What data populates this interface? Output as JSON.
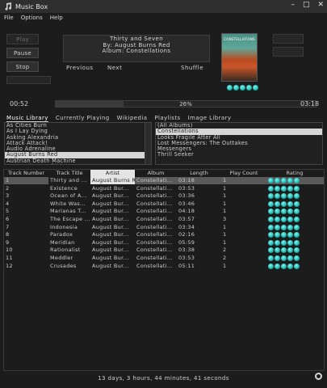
{
  "window": {
    "title": "Music Box",
    "minimize": "–",
    "maximize": "□",
    "close": "✕"
  },
  "menu": [
    "File",
    "Options",
    "Help"
  ],
  "controls": {
    "play": "Play",
    "pause": "Pause",
    "stop": "Stop",
    "previous": "Previous",
    "next": "Next",
    "shuffle": "Shuffle"
  },
  "now_playing": {
    "line1": "Thirty and Seven",
    "line2": "By: August Burns Red",
    "line3": "Album: Constellations"
  },
  "album_art": {
    "label": "CONSTELLATIONS"
  },
  "rating_stars": 5,
  "progress": {
    "elapsed": "00:52",
    "percent_label": "26%",
    "fraction": 0.26,
    "total": "03:18"
  },
  "tabs": [
    "Music Library",
    "Currently Playing",
    "Wikipedia",
    "Playlists",
    "Image Library"
  ],
  "artists": [
    "As Cities Burn",
    "As I Lay Dying",
    "Asking Alexandria",
    "Attack Attack!",
    "Audio Adrenaline",
    "August Burns Red",
    "Austrian Death Machine",
    "Avenged Sevenfold"
  ],
  "artists_selected": 5,
  "albums": [
    "(All Albums)",
    "Constellations",
    "Looks Fragile After All",
    "Lost Messengers: The Outtakes",
    "Messengers",
    "Thrill Seeker"
  ],
  "albums_selected": 1,
  "columns": [
    "Track Number",
    "Track Title",
    "Artist",
    "Album",
    "Length",
    "Play Count",
    "Rating"
  ],
  "tracks": [
    {
      "num": "1",
      "title": "Thirty and ...",
      "artist": "August Burns Red",
      "album": "Constellati...",
      "length": "03:18",
      "plays": "1",
      "rating": 5
    },
    {
      "num": "2",
      "title": "Existence",
      "artist": "August Bur...",
      "album": "Constellati...",
      "length": "03:53",
      "plays": "1",
      "rating": 5
    },
    {
      "num": "3",
      "title": "Ocean of A...",
      "artist": "August Bur...",
      "album": "Constellati...",
      "length": "03:36",
      "plays": "1",
      "rating": 5
    },
    {
      "num": "4",
      "title": "White Was...",
      "artist": "August Bur...",
      "album": "Constellati...",
      "length": "03:46",
      "plays": "1",
      "rating": 5
    },
    {
      "num": "5",
      "title": "Marianas T...",
      "artist": "August Bur...",
      "album": "Constellati...",
      "length": "04:18",
      "plays": "1",
      "rating": 5
    },
    {
      "num": "6",
      "title": "The Escape ...",
      "artist": "August Bur...",
      "album": "Constellati...",
      "length": "03:57",
      "plays": "3",
      "rating": 5
    },
    {
      "num": "7",
      "title": "Indonesia",
      "artist": "August Bur...",
      "album": "Constellati...",
      "length": "03:34",
      "plays": "1",
      "rating": 5
    },
    {
      "num": "8",
      "title": "Paradox",
      "artist": "August Bur...",
      "album": "Constellati...",
      "length": "02:16",
      "plays": "1",
      "rating": 5
    },
    {
      "num": "9",
      "title": "Meridian",
      "artist": "August Bur...",
      "album": "Constellati...",
      "length": "05:59",
      "plays": "1",
      "rating": 5
    },
    {
      "num": "10",
      "title": "Rationalist",
      "artist": "August Bur...",
      "album": "Constellati...",
      "length": "03:38",
      "plays": "2",
      "rating": 5
    },
    {
      "num": "11",
      "title": "Meddler",
      "artist": "August Bur...",
      "album": "Constellati...",
      "length": "03:53",
      "plays": "2",
      "rating": 5
    },
    {
      "num": "12",
      "title": "Crusades",
      "artist": "August Bur...",
      "album": "Constellati...",
      "length": "05:11",
      "plays": "1",
      "rating": 5
    }
  ],
  "footer": {
    "total": "13 days, 3 hours, 44 minutes, 41 seconds"
  },
  "colors": {
    "background": "#1c1c1c",
    "star": "#1fb7b0",
    "selection": "#d6d6d6"
  }
}
